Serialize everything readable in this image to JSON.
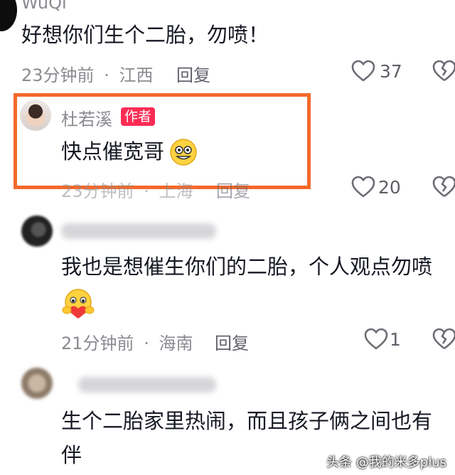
{
  "comments": [
    {
      "username": "WuQi",
      "text": "好想你们生个二胎，勿喷！",
      "time": "23分钟前",
      "dot": "·",
      "location": "江西",
      "reply_label": "回复",
      "likes": "37"
    },
    {
      "username": "杜若溪",
      "badge": "作者",
      "text": "快点催宽哥",
      "emoji": "grinning-emoji",
      "time": "23分钟前",
      "dot": "·",
      "location": "上海",
      "reply_label": "回复",
      "likes": "20"
    },
    {
      "text": "我也是想催生你们的二胎，个人观点勿喷",
      "emoji": "heart-hug-emoji",
      "time": "21分钟前",
      "dot": "·",
      "location": "海南",
      "reply_label": "回复",
      "likes": "1"
    },
    {
      "text_line1": "生个二胎家里热闹，而且孩子俩之间也有",
      "text_line2": "伴"
    }
  ],
  "watermark": "头条 @我的米多plus",
  "colors": {
    "highlight_border": "#f2692a",
    "author_badge": "#fe2c55"
  }
}
